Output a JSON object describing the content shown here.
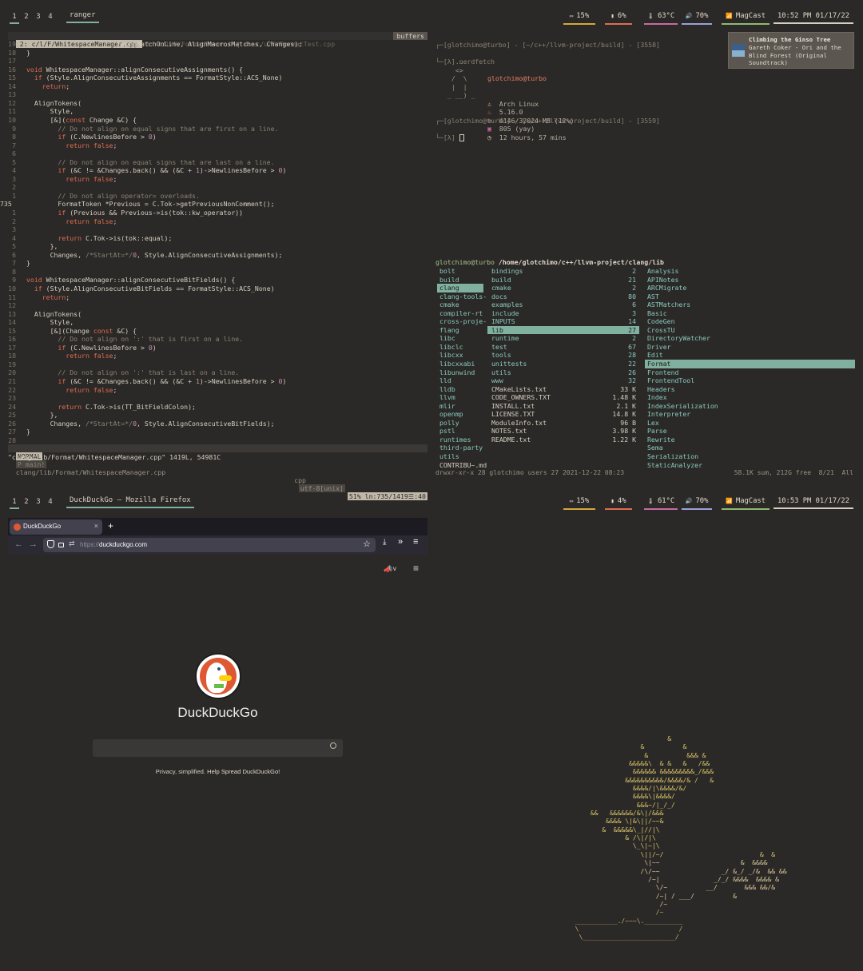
{
  "top_bar": {
    "workspaces": [
      "1",
      "2",
      "3",
      "4"
    ],
    "window_title": "ranger",
    "stats": [
      {
        "icon": "battery-icon",
        "value": "15%",
        "color": "#d4a93a"
      },
      {
        "icon": "storage-icon",
        "value": "6%",
        "color": "#e06c50"
      },
      {
        "icon": "thermometer-icon",
        "value": "63°C",
        "color": "#c86aa0"
      },
      {
        "icon": "volume-icon",
        "value": "70%",
        "color": "#9aa0d8"
      },
      {
        "icon": "wifi-icon",
        "value": "MagCast",
        "color": "#8fb870"
      }
    ],
    "clock": "10:52 PM 01/17/22"
  },
  "bottom_bar": {
    "workspaces": [
      "1",
      "2",
      "3",
      "4"
    ],
    "window_title": "DuckDuckGo — Mozilla Firefox",
    "stats": [
      {
        "icon": "battery-icon",
        "value": "15%",
        "color": "#d4a93a"
      },
      {
        "icon": "storage-icon",
        "value": "4%",
        "color": "#e06c50"
      },
      {
        "icon": "thermometer-icon",
        "value": "61°C",
        "color": "#c86aa0"
      },
      {
        "icon": "volume-icon",
        "value": "70%",
        "color": "#9aa0d8"
      },
      {
        "icon": "wifi-icon",
        "value": "MagCast",
        "color": "#8fb870"
      }
    ],
    "clock": "10:53 PM 01/17/22"
  },
  "vim": {
    "tabs": " 2: c/l/F/WhitespaceManager.cpp ",
    "tabs_rest": " 3: c/l/F/FormatToken.h | 4: c/u/F/FormatTest.cpp",
    "buffers": "buffers",
    "lines": [
      {
        "n": "19",
        "t": "                       FoundMatchOnLine, AlignMacrosMatches, Changes);"
      },
      {
        "n": "18",
        "t": "}"
      },
      {
        "n": "17",
        "t": ""
      },
      {
        "n": "16",
        "t": "void WhitespaceManager::alignConsecutiveAssignments() {"
      },
      {
        "n": "15",
        "t": "  if (Style.AlignConsecutiveAssignments == FormatStyle::ACS_None)"
      },
      {
        "n": "14",
        "t": "    return;"
      },
      {
        "n": "13",
        "t": ""
      },
      {
        "n": "12",
        "t": "  AlignTokens("
      },
      {
        "n": "11",
        "t": "      Style,"
      },
      {
        "n": "10",
        "t": "      [&](const Change &C) {"
      },
      {
        "n": "9",
        "t": "        // Do not align on equal signs that are first on a line."
      },
      {
        "n": "8",
        "t": "        if (C.NewlinesBefore > 0)"
      },
      {
        "n": "7",
        "t": "          return false;"
      },
      {
        "n": "6",
        "t": ""
      },
      {
        "n": "5",
        "t": "        // Do not align on equal signs that are last on a line."
      },
      {
        "n": "4",
        "t": "        if (&C != &Changes.back() && (&C + 1)->NewlinesBefore > 0)"
      },
      {
        "n": "3",
        "t": "          return false;"
      },
      {
        "n": "2",
        "t": ""
      },
      {
        "n": "1",
        "t": "        // Do not align operator= overloads."
      },
      {
        "n": "735",
        "t": "        FormatToken *Previous = C.Tok->getPreviousNonComment();"
      },
      {
        "n": "1",
        "t": "        if (Previous && Previous->is(tok::kw_operator))"
      },
      {
        "n": "2",
        "t": "          return false;"
      },
      {
        "n": "3",
        "t": ""
      },
      {
        "n": "4",
        "t": "        return C.Tok->is(tok::equal);"
      },
      {
        "n": "5",
        "t": "      },"
      },
      {
        "n": "6",
        "t": "      Changes, /*StartAt=*/0, Style.AlignConsecutiveAssignments);"
      },
      {
        "n": "7",
        "t": "}"
      },
      {
        "n": "8",
        "t": ""
      },
      {
        "n": "9",
        "t": "void WhitespaceManager::alignConsecutiveBitFields() {"
      },
      {
        "n": "10",
        "t": "  if (Style.AlignConsecutiveBitFields == FormatStyle::ACS_None)"
      },
      {
        "n": "11",
        "t": "    return;"
      },
      {
        "n": "12",
        "t": ""
      },
      {
        "n": "13",
        "t": "  AlignTokens("
      },
      {
        "n": "14",
        "t": "      Style,"
      },
      {
        "n": "15",
        "t": "      [&](Change const &C) {"
      },
      {
        "n": "16",
        "t": "        // Do not align on ':' that is first on a line."
      },
      {
        "n": "17",
        "t": "        if (C.NewlinesBefore > 0)"
      },
      {
        "n": "18",
        "t": "          return false;"
      },
      {
        "n": "19",
        "t": ""
      },
      {
        "n": "20",
        "t": "        // Do not align on ':' that is last on a line."
      },
      {
        "n": "21",
        "t": "        if (&C != &Changes.back() && (&C + 1)->NewlinesBefore > 0)"
      },
      {
        "n": "22",
        "t": "          return false;"
      },
      {
        "n": "23",
        "t": ""
      },
      {
        "n": "24",
        "t": "        return C.Tok->is(TT_BitFieldColon);"
      },
      {
        "n": "25",
        "t": "      },"
      },
      {
        "n": "26",
        "t": "      Changes, /*StartAt=*/0, Style.AlignConsecutiveBitFields);"
      },
      {
        "n": "27",
        "t": "}"
      },
      {
        "n": "28",
        "t": ""
      }
    ],
    "mode": "NORMAL",
    "branch": "P main!",
    "file": "clang/lib/Format/WhitespaceManager.cpp",
    "ft": "cpp",
    "enc": "utf-8[unix]",
    "pos": "51% ln:735/1419☰:40",
    "msg": "\"clang/lib/Format/WhitespaceManager.cpp\" 1419L, 54981C"
  },
  "terminal": {
    "prompt1": "┌─[glotchimo@turbo] - [~/c++/llvm-project/build] - [3558]",
    "cmd1": "└─[λ] nerdfetch",
    "user": "glotchimo@turbo",
    "fetch": [
      "Arch Linux",
      "5.16.0",
      "4146/32024 MB (12%)",
      "805 (yay)",
      "12 hours, 57 mins"
    ],
    "art": [
      "   ..   ",
      "   <>   ",
      "  /  \\  ",
      "  |  |  ",
      " _ __) _"
    ],
    "prompt2": "┌─[glotchimo@turbo] - [~/c++/llvm-project/build] - [3559]",
    "cmd2": "└─[λ] "
  },
  "notification": {
    "title": "Climbing the Ginso Tree",
    "body": "Gareth Coker - Ori and the Blind Forest (Original Soundtrack)",
    "line2": "Blind Forest (Original",
    "line3": "Soundtrack)",
    "line1": "Gareth Coker - Ori and the"
  },
  "ranger": {
    "header": "glotchimo@turbo",
    "path": "/home/glotchimo/c++/llvm-project/clang/lib",
    "col1": [
      "bolt",
      "build",
      "clang",
      "clang-tools-",
      "cmake",
      "compiler-rt",
      "cross-proje-",
      "flang",
      "libc",
      "libclc",
      "libcxx",
      "libcxxabi",
      "libunwind",
      "lld",
      "lldb",
      "llvm",
      "mlir",
      "openmp",
      "polly",
      "pstl",
      "runtimes",
      "third-party",
      "utils",
      "CONTRIBU~.md"
    ],
    "col2": [
      [
        "bindings",
        "2"
      ],
      [
        "build",
        "21"
      ],
      [
        "cmake",
        "2"
      ],
      [
        "docs",
        "80"
      ],
      [
        "examples",
        "6"
      ],
      [
        "include",
        "3"
      ],
      [
        "INPUTS",
        "14"
      ],
      [
        "lib",
        "27"
      ],
      [
        "runtime",
        "2"
      ],
      [
        "test",
        "67"
      ],
      [
        "tools",
        "28"
      ],
      [
        "unittests",
        "22"
      ],
      [
        "utils",
        "26"
      ],
      [
        "www",
        "32"
      ],
      [
        "CMakeLists.txt",
        "33 K"
      ],
      [
        "CODE_OWNERS.TXT",
        "1.48 K"
      ],
      [
        "INSTALL.txt",
        "2.1 K"
      ],
      [
        "LICENSE.TXT",
        "14.8 K"
      ],
      [
        "ModuleInfo.txt",
        "96 B"
      ],
      [
        "NOTES.txt",
        "3.98 K"
      ],
      [
        "README.txt",
        "1.22 K"
      ]
    ],
    "col3": [
      "Analysis",
      "APINotes",
      "ARCMigrate",
      "AST",
      "ASTMatchers",
      "Basic",
      "CodeGen",
      "CrossTU",
      "DirectoryWatcher",
      "Driver",
      "Edit",
      "Format",
      "Frontend",
      "FrontendTool",
      "Headers",
      "Index",
      "IndexSerialization",
      "Interpreter",
      "Lex",
      "Parse",
      "Rewrite",
      "Sema",
      "Serialization",
      "StaticAnalyzer"
    ],
    "status_left": "drwxr-xr-x 28 glotchimo users 27 2021-12-22 08:23",
    "status_right": "58.1K sum, 212G free  8/21  All"
  },
  "firefox": {
    "tab_title": "DuckDuckGo",
    "url_scheme": "https://",
    "url_host": "duckduckgo.com",
    "brand": "DuckDuckGo",
    "tagline": "Privacy, simplified.",
    "tagline_link": "Help Spread DuckDuckGo!",
    "search_placeholder": ""
  },
  "ascii_tree": [
    "                          &",
    "                   &          &",
    "                    &          &&& &",
    "                &&&&&\\  & &   &   /&&",
    "                 &&&&&& &&&&&&&&&_/&&&",
    "               &&&&&&&&&&/&&&&/& /   &",
    "                 &&&&/|\\&&&&/&/",
    "                 &&&&\\|&&&&/",
    "                  &&&~/|_/_/",
    "      &&   &&&&&&/&\\|/&&&",
    "          &&&& \\|&\\||/~~&",
    "         &  &&&&&\\_|//|\\",
    "               & /\\|/|\\",
    "                 \\_\\|~|\\",
    "                   \\||/~/                         &  &",
    "                    \\|~~                     &  &&&&",
    "                   /\\/~~                _/ &_/ _/&  && &&",
    "                     /~|              _/_/ &&&&  &&&& &",
    "                       \\/~          __/       &&& &&/&",
    "                       /~| / ___/          &",
    "                        /~",
    "                       /~",
    "  ___________./~~~\\.__________",
    "  \\                          /",
    "   \\________________________/"
  ]
}
